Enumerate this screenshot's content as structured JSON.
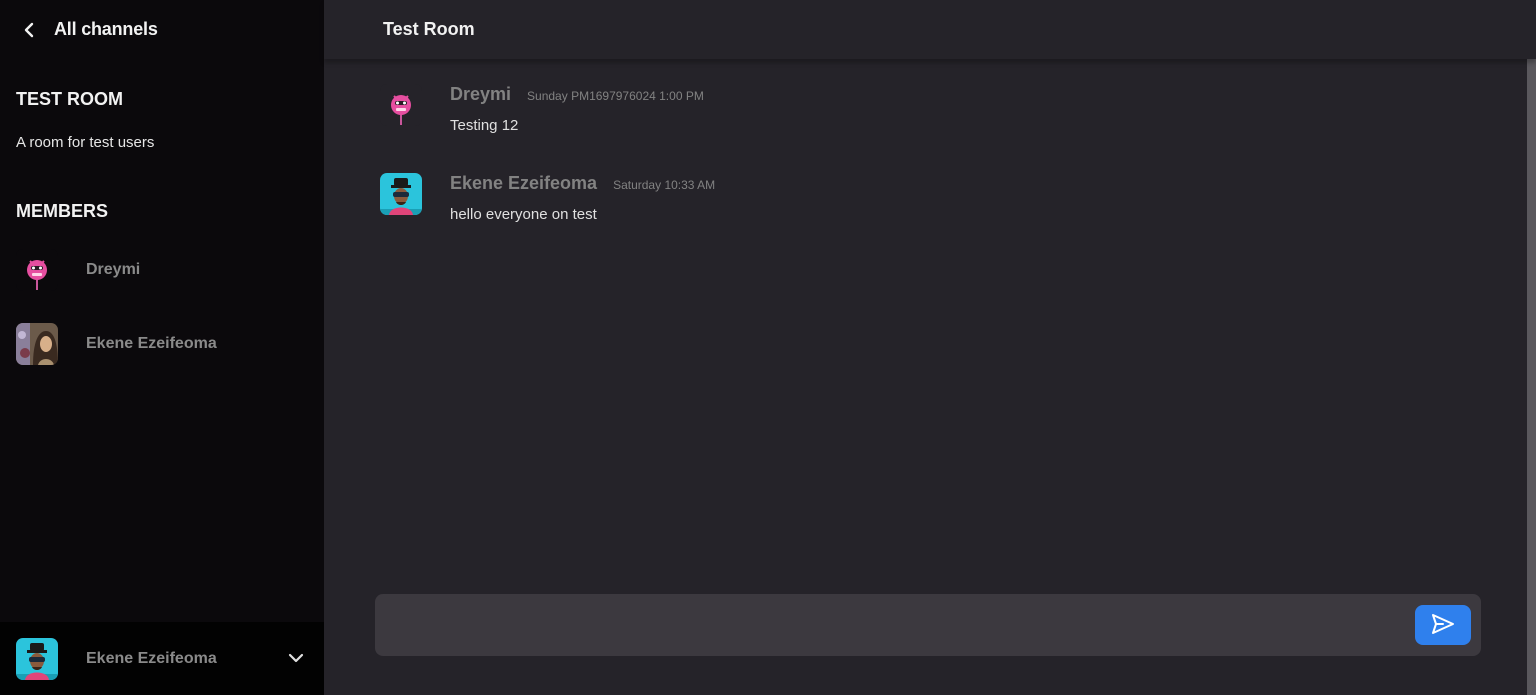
{
  "sidebar": {
    "header_title": "All channels",
    "back_icon": "chevron-left-icon",
    "channel_name": "TEST ROOM",
    "channel_description": "A room for test users",
    "members_heading": "MEMBERS",
    "members": [
      {
        "name": "Dreymi",
        "avatar": "pink-creature-avatar"
      },
      {
        "name": "Ekene Ezeifeoma",
        "avatar": "woman-photo-avatar"
      }
    ],
    "current_user": {
      "name": "Ekene Ezeifeoma",
      "avatar": "man-hat-avatar",
      "menu_icon": "chevron-down-icon"
    }
  },
  "main": {
    "room_title": "Test Room",
    "messages": [
      {
        "author": "Dreymi",
        "time": "Sunday PM1697976024 1:00 PM",
        "text": "Testing 12",
        "avatar": "pink-creature-avatar"
      },
      {
        "author": "Ekene Ezeifeoma",
        "time": "Saturday 10:33 AM",
        "text": "hello everyone on test",
        "avatar": "man-hat-avatar"
      }
    ],
    "composer": {
      "placeholder": "",
      "value": "",
      "send_icon": "send-icon"
    }
  },
  "colors": {
    "sidebar_bg": "#0b090c",
    "main_bg": "#252329",
    "input_bg": "#3c393f",
    "accent": "#2f80ed",
    "muted_text": "#828282"
  }
}
